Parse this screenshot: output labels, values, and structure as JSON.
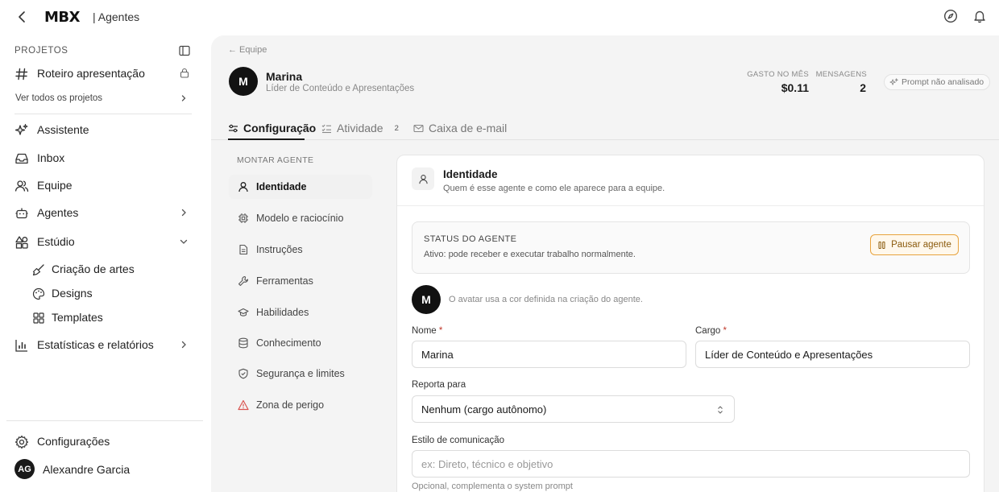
{
  "topbar": {
    "logo": "MBX",
    "section": "| Agentes"
  },
  "sidebar": {
    "projects_label": "PROJETOS",
    "project": {
      "name": "Roteiro apresentação"
    },
    "see_all": "Ver todos os projetos",
    "items": [
      {
        "label": "Assistente"
      },
      {
        "label": "Inbox"
      },
      {
        "label": "Equipe"
      },
      {
        "label": "Agentes"
      },
      {
        "label": "Estúdio"
      }
    ],
    "studio_sub": [
      {
        "label": "Criação de artes"
      },
      {
        "label": "Designs"
      },
      {
        "label": "Templates"
      }
    ],
    "stats": "Estatísticas e relatórios",
    "settings": "Configurações",
    "user": {
      "initials": "AG",
      "name": "Alexandre Garcia"
    }
  },
  "agent": {
    "breadcrumb": "← Equipe",
    "initial": "M",
    "name": "Marina",
    "role": "Líder de Conteúdo e Apresentações",
    "spend_label": "GASTO NO MÊS",
    "spend_value": "$0.11",
    "messages_label": "MENSAGENS",
    "messages_value": "2",
    "prompt_status": "Prompt não analisado"
  },
  "tabs": [
    {
      "label": "Configuração"
    },
    {
      "label": "Atividade",
      "count": "2"
    },
    {
      "label": "Caixa de e-mail"
    }
  ],
  "build": {
    "label": "MONTAR AGENTE",
    "items": [
      {
        "label": "Identidade"
      },
      {
        "label": "Modelo e raciocínio"
      },
      {
        "label": "Instruções"
      },
      {
        "label": "Ferramentas"
      },
      {
        "label": "Habilidades"
      },
      {
        "label": "Conhecimento"
      },
      {
        "label": "Segurança e limites"
      },
      {
        "label": "Zona de perigo"
      }
    ]
  },
  "identity": {
    "title": "Identidade",
    "subtitle": "Quem é esse agente e como ele aparece para a equipe.",
    "status_title": "STATUS DO AGENTE",
    "status_text": "Ativo: pode receber e executar trabalho normalmente.",
    "pause_button": "Pausar agente",
    "avatar_initial": "M",
    "avatar_note": "O avatar usa a cor definida na criação do agente.",
    "name_label": "Nome",
    "name_value": "Marina",
    "role_label": "Cargo",
    "role_value": "Líder de Conteúdo e Apresentações",
    "reports_label": "Reporta para",
    "reports_value": "Nenhum (cargo autônomo)",
    "style_label": "Estilo de comunicação",
    "style_placeholder": "ex: Direto, técnico e objetivo",
    "style_hint": "Opcional, complementa o system prompt",
    "required_mark": "*"
  },
  "colors": {
    "accent": "#1a1a1a",
    "warning": "#e8a33d",
    "danger": "#d9534f",
    "panel_bg": "#f4f4f4"
  }
}
